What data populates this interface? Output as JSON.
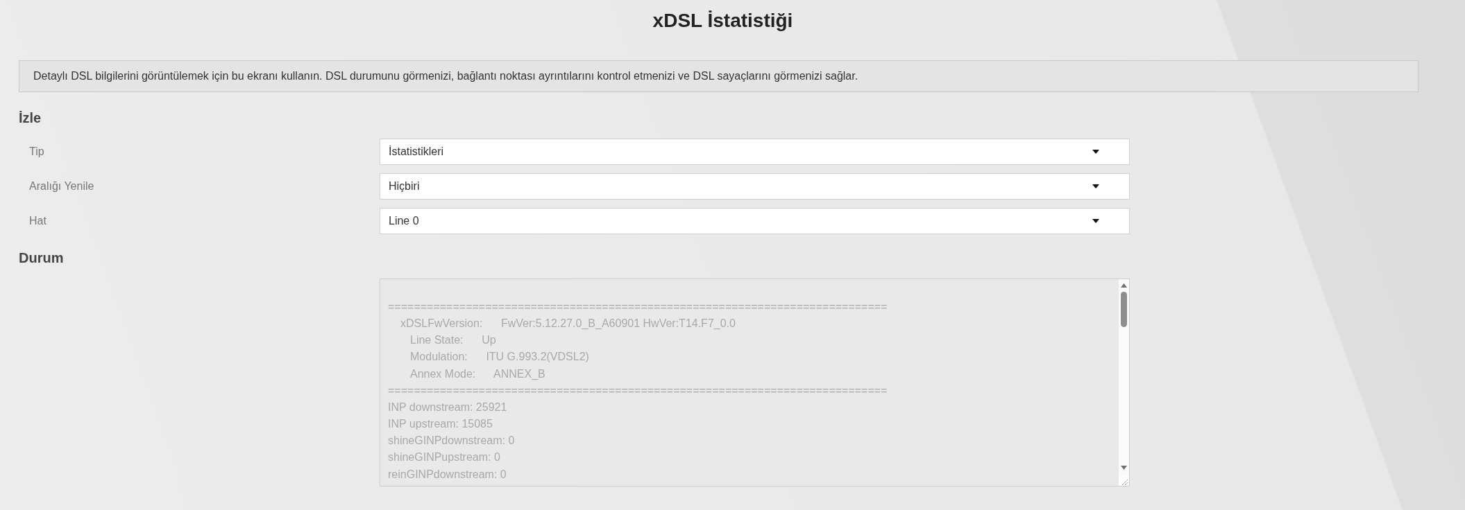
{
  "title": "xDSL İstatistiği",
  "description": "Detaylı DSL bilgilerini görüntülemek için bu ekranı kullanın. DSL durumunu görmenizi, bağlantı noktası ayrıntılarını kontrol etmenizi ve DSL sayaçlarını görmenizi sağlar.",
  "monitor": {
    "heading": "İzle",
    "fields": [
      {
        "label": "Tip",
        "value": "İstatistikleri"
      },
      {
        "label": "Aralığı Yenile",
        "value": "Hiçbiri"
      },
      {
        "label": "Hat",
        "value": "Line 0"
      }
    ]
  },
  "status": {
    "heading": "Durum",
    "disabled": true,
    "lines": [
      {
        "kind": "separator",
        "text": "============================================================================="
      },
      {
        "kind": "version",
        "text": "xDSLFwVersion:      FwVer:5.12.27.0_B_A60901 HwVer:T14.F7_0.0"
      },
      {
        "kind": "field",
        "text": "Line State:      Up"
      },
      {
        "kind": "field",
        "text": "Modulation:      ITU G.993.2(VDSL2)"
      },
      {
        "kind": "field",
        "text": "Annex Mode:      ANNEX_B"
      },
      {
        "kind": "separator",
        "text": "============================================================================="
      },
      {
        "kind": "plain",
        "text": "INP downstream: 25921"
      },
      {
        "kind": "plain",
        "text": "INP upstream: 15085"
      },
      {
        "kind": "plain",
        "text": "shineGINPdownstream: 0"
      },
      {
        "kind": "plain",
        "text": "shineGINPupstream: 0"
      },
      {
        "kind": "plain",
        "text": "reinGINPdownstream: 0"
      }
    ]
  }
}
